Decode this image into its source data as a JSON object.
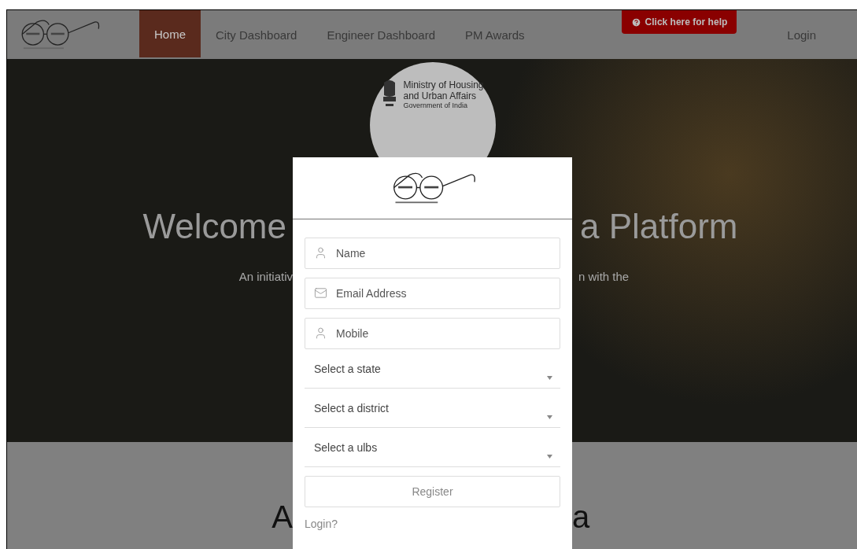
{
  "nav": {
    "items": [
      {
        "label": "Home",
        "selected": true
      },
      {
        "label": "City Dashboard",
        "selected": false
      },
      {
        "label": "Engineer Dashboard",
        "selected": false
      },
      {
        "label": "PM Awards",
        "selected": false
      }
    ],
    "help_button": "Click here for help",
    "login": "Login"
  },
  "hero": {
    "ministry": [
      "Ministry of Housing",
      "and Urban Affairs",
      "Government of India"
    ],
    "title_left": "Welcome",
    "title_right": "a Platform",
    "subtitle_left": "An initiativ",
    "subtitle_right": "n with the"
  },
  "section": {
    "heading_left": "A",
    "heading_right": "a"
  },
  "modal": {
    "fields": [
      {
        "kind": "person",
        "placeholder": "Name"
      },
      {
        "kind": "email",
        "placeholder": "Email Address"
      },
      {
        "kind": "person",
        "placeholder": "Mobile"
      }
    ],
    "selects": [
      "Select a state",
      "Select a district",
      "Select a ulbs"
    ],
    "register": "Register",
    "login_link": "Login?"
  }
}
